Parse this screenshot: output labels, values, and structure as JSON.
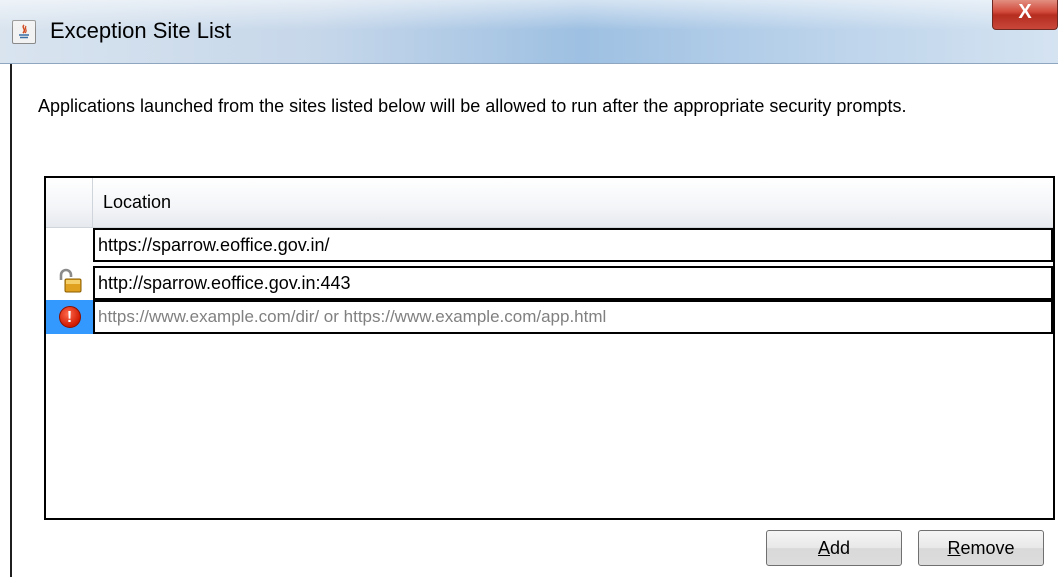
{
  "window": {
    "title": "Exception Site List",
    "close_label": "X",
    "app_icon": "java-icon"
  },
  "description": "Applications launched from the sites listed below will be allowed to run after the appropriate security prompts.",
  "table": {
    "header": "Location",
    "rows": [
      {
        "icon": "",
        "value": "https://sparrow.eoffice.gov.in/",
        "placeholder": ""
      },
      {
        "icon": "unlocked-padlock-icon",
        "value": "http://sparrow.eoffice.gov.in:443",
        "placeholder": ""
      },
      {
        "icon": "error-icon",
        "value": "",
        "placeholder": "https://www.example.com/dir/ or https://www.example.com/app.html",
        "selected": true
      }
    ]
  },
  "buttons": {
    "add_label": "Add",
    "add_accel": "A",
    "add_rest": "dd",
    "remove_label": "Remove",
    "remove_accel": "R",
    "remove_rest": "emove"
  },
  "colors": {
    "selection": "#3399ff",
    "error": "#d01a00",
    "close_button": "#c8473a"
  }
}
